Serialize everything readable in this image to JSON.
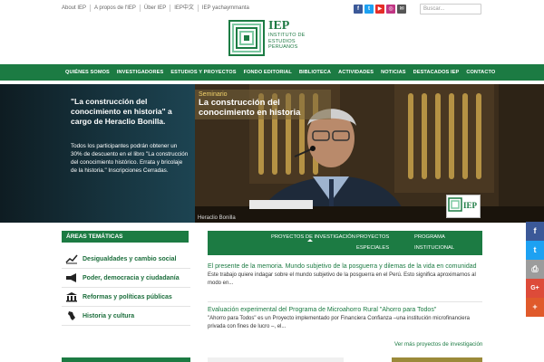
{
  "topbar": {
    "links": [
      "About IEP",
      "A propos de l'IEP",
      "Über IEP",
      "IEP中文",
      "IEP yachaymmanta"
    ],
    "search_placeholder": "Buscar...",
    "socials": [
      {
        "name": "facebook-icon",
        "glyph": "f",
        "color": "#3b5998"
      },
      {
        "name": "twitter-icon",
        "glyph": "t",
        "color": "#1da1f2"
      },
      {
        "name": "youtube-icon",
        "glyph": "▶",
        "color": "#e52d27"
      },
      {
        "name": "instagram-icon",
        "glyph": "◎",
        "color": "#c13584"
      },
      {
        "name": "mail-icon",
        "glyph": "✉",
        "color": "#555555"
      }
    ]
  },
  "logo": {
    "acronym": "IEP",
    "line1": "INSTITUTO DE",
    "line2": "ESTUDIOS",
    "line3": "PERUANOS"
  },
  "nav": {
    "items": [
      "QUIÉNES SOMOS",
      "INVESTIGADORES",
      "ESTUDIOS Y PROYECTOS",
      "FONDO EDITORIAL",
      "BIBLIOTECA",
      "ACTIVIDADES",
      "NOTICIAS",
      "DESTACADOS IEP",
      "CONTACTO"
    ]
  },
  "hero": {
    "title": "\"La construcción del conocimiento en historia\" a cargo de Heraclio Bonilla.",
    "description": "Todos los participantes podrán obtener un 30% de descuento en el libro \"La construcción del conocimiento histórico. Errata y bricolaje de la historia.\" Inscripciones Cerradas.",
    "kicker": "Seminario",
    "slide_title": "La construcción del conocimiento en historia",
    "caption": "Heraclio Bonilla",
    "badge_text": "IEP"
  },
  "areas": {
    "heading": "ÁREAS TEMÁTICAS",
    "items": [
      {
        "label": "Desigualdades y cambio social",
        "icon": "chart-icon"
      },
      {
        "label": "Poder, democracia y ciudadanía",
        "icon": "megaphone-icon"
      },
      {
        "label": "Reformas y políticas públicas",
        "icon": "building-icon"
      },
      {
        "label": "Historia y cultura",
        "icon": "map-icon"
      }
    ]
  },
  "projects": {
    "tabs": {
      "research": "PROYECTOS DE INVESTIGACIÓN",
      "special_1": "PROYECTOS",
      "special_2": "ESPECIALES",
      "program_1": "PROGRAMA",
      "program_2": "INSTITUCIONAL"
    },
    "items": [
      {
        "title": "El presente de la memoria. Mundo subjetivo de la posguerra y dilemas de la vida en comunidad",
        "text1": "Este trabajo quiere indagar sobre el mundo subjetivo de la posguerra en el Perú. Esto significa aproximarnos al",
        "text2": "modo en..."
      },
      {
        "title": "Evaluación experimental del Programa de Microahorro Rural \"Ahorro para Todos\"",
        "text1": "\"Ahorro para Todos\" es un Proyecto implementado por Financiera Confianza –una institución microfinanciera",
        "text2": "privada con fines de lucro –, el..."
      }
    ],
    "more": "Ver más proyectos de investigación"
  },
  "share": [
    {
      "name": "facebook-share-icon",
      "glyph": "f",
      "color": "#3b5998"
    },
    {
      "name": "twitter-share-icon",
      "glyph": "t",
      "color": "#1da1f2"
    },
    {
      "name": "print-share-icon",
      "glyph": "⎙",
      "color": "#9c9c9c"
    },
    {
      "name": "googleplus-share-icon",
      "glyph": "G+",
      "color": "#dd4b39"
    },
    {
      "name": "more-share-icon",
      "glyph": "+",
      "color": "#e05a2b"
    }
  ],
  "colors": {
    "brand_green": "#1c7b43",
    "accent_gold": "#f2d36b"
  }
}
